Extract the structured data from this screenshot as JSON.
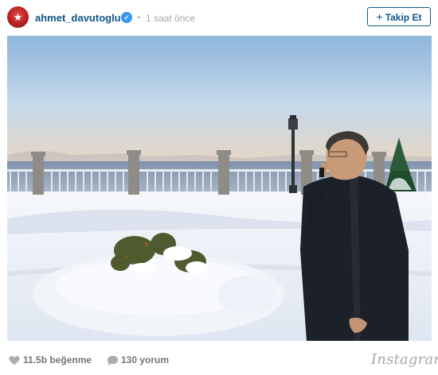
{
  "post": {
    "username": "ahmet_davutoglu",
    "verified_icon": "verified-badge-icon",
    "separator": "•",
    "timestamp": "1 saat önce",
    "follow_label": "Takip Et",
    "follow_plus": "+"
  },
  "photo": {
    "scene": "snow-covered-garden-by-the-bosphorus"
  },
  "stats": {
    "likes": "11.5b beğenme",
    "comments": "130 yorum",
    "like_icon": "heart-icon",
    "comment_icon": "comment-bubble-icon"
  },
  "branding": {
    "logo_text": "Instagram"
  },
  "colors": {
    "username": "#125688",
    "verified": "#3897f0",
    "muted": "#a5a7aa",
    "follow_border": "#125688",
    "stat_text": "#70757a"
  }
}
